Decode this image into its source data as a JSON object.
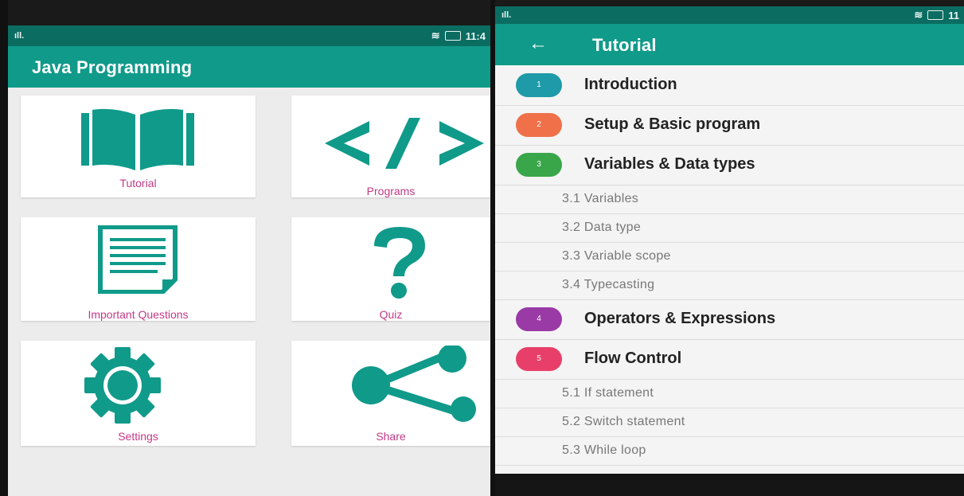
{
  "left": {
    "status_signal": "ıll.",
    "status_time": "11:4",
    "app_title": "Java Programming",
    "cards": [
      {
        "label": "Tutorial",
        "icon": "book-icon"
      },
      {
        "label": "Programs",
        "icon": "code-icon"
      },
      {
        "label": "Important Questions",
        "icon": "document-icon"
      },
      {
        "label": "Quiz",
        "icon": "question-icon"
      },
      {
        "label": "Settings",
        "icon": "gear-icon"
      },
      {
        "label": "Share",
        "icon": "share-icon"
      }
    ]
  },
  "right": {
    "status_signal": "ıll.",
    "status_time": "11",
    "title": "Tutorial",
    "back_icon": "←",
    "chapters": [
      {
        "num": "1",
        "title": "Introduction",
        "color": "#1f9aa8"
      },
      {
        "num": "2",
        "title": "Setup & Basic program",
        "color": "#f0704a"
      },
      {
        "num": "3",
        "title": "Variables & Data types",
        "color": "#3aa64a"
      },
      {
        "num": "4",
        "title": "Operators & Expressions",
        "color": "#9a3aa6"
      },
      {
        "num": "5",
        "title": "Flow Control",
        "color": "#e83f6a"
      }
    ],
    "subs3": [
      "3.1 Variables",
      "3.2 Data type",
      "3.3 Variable scope",
      "3.4 Typecasting"
    ],
    "subs5": [
      "5.1 If statement",
      "5.2 Switch statement",
      "5.3 While loop"
    ]
  },
  "colors": {
    "teal": "#109a8a",
    "teal_dark": "#0b6d62",
    "label_pink": "#c23a86"
  }
}
